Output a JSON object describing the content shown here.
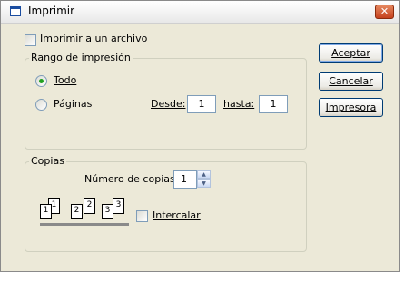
{
  "window": {
    "title": "Imprimir"
  },
  "print_to_file": {
    "label": "Imprimir a un archivo",
    "checked": false
  },
  "range": {
    "legend": "Rango de impresión",
    "all_label": "Todo",
    "pages_label": "Páginas",
    "from_label": "Desde:",
    "from_value": "1",
    "to_label": "hasta:",
    "to_value": "1",
    "selected": "all"
  },
  "copies": {
    "legend": "Copias",
    "count_label": "Número de copias:",
    "count_value": "1",
    "collate_label": "Intercalar",
    "collate_checked": false,
    "collate_pages": [
      {
        "back": "1",
        "front": "1"
      },
      {
        "back": "2",
        "front": "2"
      },
      {
        "back": "3",
        "front": "3"
      }
    ]
  },
  "buttons": {
    "ok": "Aceptar",
    "cancel": "Cancelar",
    "printer": "Impresora"
  },
  "icons": {
    "window": "window-icon",
    "close": "close-icon",
    "spin_up": "spin-up-icon",
    "spin_down": "spin-down-icon"
  }
}
